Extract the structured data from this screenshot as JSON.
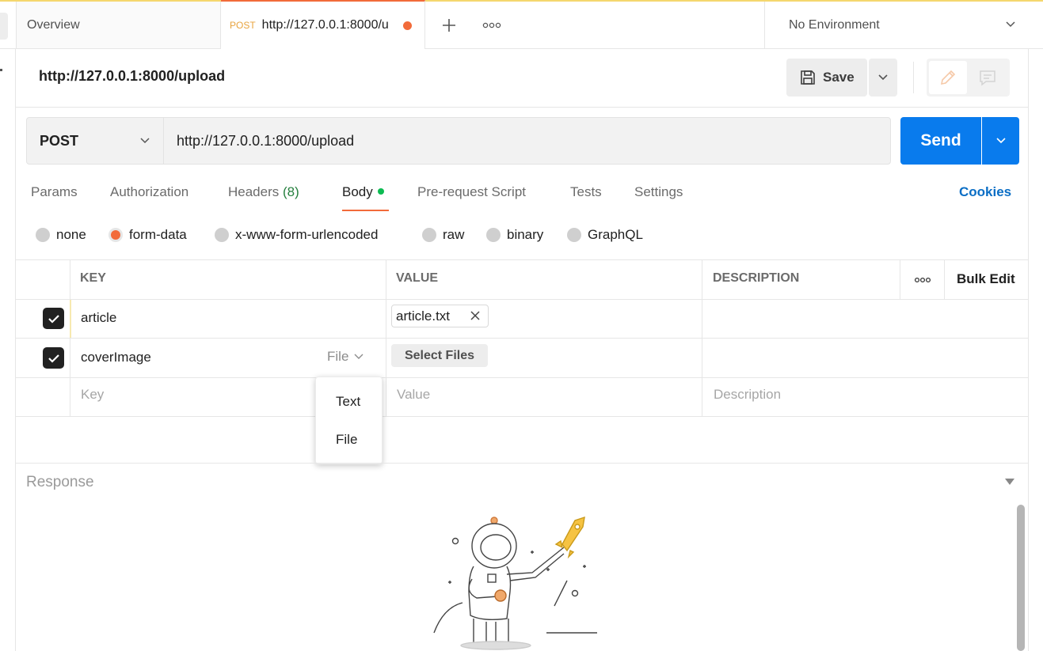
{
  "tabs": {
    "overview_label": "Overview",
    "active": {
      "method": "POST",
      "url": "http://127.0.0.1:8000/u"
    },
    "environment": "No Environment"
  },
  "request": {
    "title": "http://127.0.0.1:8000/upload",
    "save_label": "Save",
    "method": "POST",
    "url": "http://127.0.0.1:8000/upload",
    "send_label": "Send"
  },
  "request_tabs": {
    "params": "Params",
    "authorization": "Authorization",
    "headers": "Headers",
    "headers_count": "(8)",
    "body": "Body",
    "pre_request": "Pre-request Script",
    "tests": "Tests",
    "settings": "Settings",
    "cookies": "Cookies"
  },
  "body_types": [
    "none",
    "form-data",
    "x-www-form-urlencoded",
    "raw",
    "binary",
    "GraphQL"
  ],
  "body_type_selected": "form-data",
  "table": {
    "headers": {
      "key": "KEY",
      "value": "VALUE",
      "description": "DESCRIPTION",
      "bulk_edit": "Bulk Edit"
    },
    "rows": [
      {
        "checked": true,
        "key": "article",
        "value_file": "article.txt"
      },
      {
        "checked": true,
        "key": "coverImage",
        "type": "File",
        "value_button": "Select Files"
      }
    ],
    "placeholders": {
      "key": "Key",
      "value": "Value",
      "description": "Description"
    }
  },
  "type_dropdown": {
    "options": [
      "Text",
      "File"
    ]
  },
  "response": {
    "title": "Response"
  },
  "colors": {
    "accent": "#f26b3a",
    "send": "#097bed",
    "link": "#0b6ec5",
    "body_dot": "#0cbb52"
  }
}
